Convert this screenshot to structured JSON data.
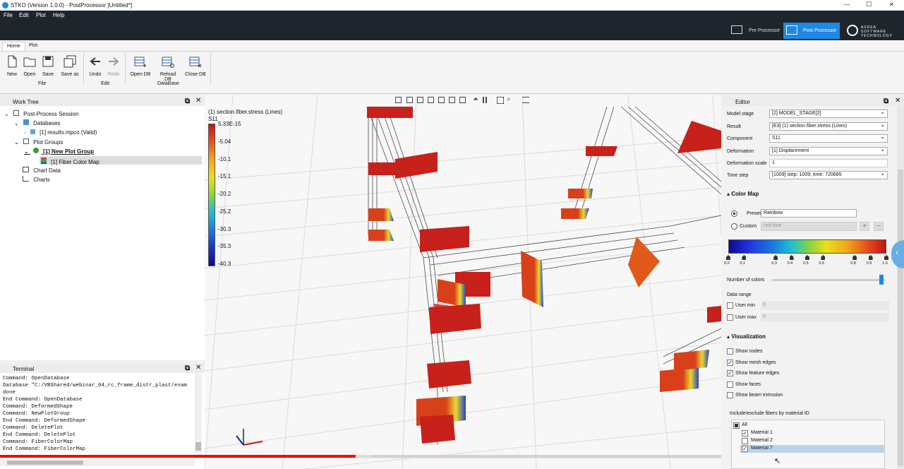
{
  "window": {
    "title": "STKO (Version 1.0.0) - PostProcessor [Untitled*]",
    "min": "—",
    "max": "☐",
    "close": "✕"
  },
  "menu": {
    "file": "File",
    "edit": "Edit",
    "plot": "Plot",
    "help": "Help"
  },
  "modes": {
    "pre": "Pre Processor",
    "post": "Post Processor",
    "brand": "ASDEA SOFTWARE TECHNOLOGY"
  },
  "ribbon": {
    "tabs": {
      "home": "Home",
      "plot": "Plot"
    },
    "buttons": {
      "new": "New",
      "open": "Open",
      "save": "Save",
      "save_as": "Save as",
      "undo": "Undo",
      "redo": "Redo",
      "open_db": "Open DB",
      "reload_db": "Reload DB",
      "close_db": "Close DB"
    },
    "groups": {
      "file": "File",
      "edit": "Edit",
      "database": "DataBase"
    }
  },
  "worktree": {
    "title": "Work Tree",
    "session": "Post-Process Session",
    "databases": "Databases",
    "db_file": "[1] results.mpco (Valid)",
    "plot_groups": "Plot Groups",
    "plot_group": "[1] New Plot Group",
    "plot": "[1] Fiber Color Map",
    "chart_data": "Chart Data",
    "charts": "Charts"
  },
  "terminal": {
    "title": "Terminal",
    "lines": [
      "Command: OpenDatabase",
      "Database \"C:/VBShared/webinar_04_rc_frame_distr_plast/exam",
      "done",
      "End Command: OpenDatabase",
      "Command: DeformedShape",
      "Command: NewPlotGroup",
      "End Command: DeformedShape",
      "Command: DeletePlot",
      "End Command: DeletePlot",
      "Command: FiberColorMap",
      "End Command: FiberColorMap"
    ]
  },
  "viewport": {
    "legend_title": "(1) section.fiber.stress (Lines)",
    "legend_component": "S11",
    "legend_ticks": [
      "5.33E-15",
      "-5.04",
      "-10.1",
      "-15.1",
      "-20.2",
      "-25.2",
      "-30.3",
      "-35.3",
      "-40.3"
    ]
  },
  "editor": {
    "title": "Editor",
    "model_stage_label": "Model stage",
    "model_stage": "[2] MODEL_STAGE[2]",
    "result_label": "Result",
    "result": "[E3] (1) section.fiber.stress (Lines)",
    "component_label": "Component",
    "component": "S11",
    "deformation_label": "Deformation",
    "deformation": "[1] Displacement",
    "deformation_scale_label": "Deformation scale",
    "deformation_scale": "1",
    "time_step_label": "Time step",
    "time_step": "[1009] step: 1009; time: 720685",
    "color_map_section": "Color Map",
    "presets_label": "Presets",
    "presets": "Rainbow",
    "custom_label": "Custom",
    "custom": "red-blue",
    "ramp_ticks": [
      "0.0",
      "0.1",
      "0.3",
      "0.4",
      "0.5",
      "0.6",
      "0.8",
      "0.9",
      "1.0"
    ],
    "number_of_colors_label": "Number of colors",
    "data_range_label": "Data range",
    "user_min_label": "User min",
    "user_min": "0",
    "user_max_label": "User max",
    "user_max": "0",
    "visualization_section": "Visualization",
    "show_nodes": "Show nodes",
    "show_mesh_edges": "Show mesh edges",
    "show_feature_edges": "Show feature edges",
    "show_faces": "Show faces",
    "show_beam_extrusion": "Show beam extrusion",
    "fibers_label": "Include/exclude fibers by material ID",
    "all": "All",
    "material1": "Material 1",
    "material2": "Material 2",
    "material7": "Material 7"
  },
  "colors": {
    "dark": "#1f252d",
    "accent": "#1e88e5",
    "fiber_red": "#c8201a"
  }
}
